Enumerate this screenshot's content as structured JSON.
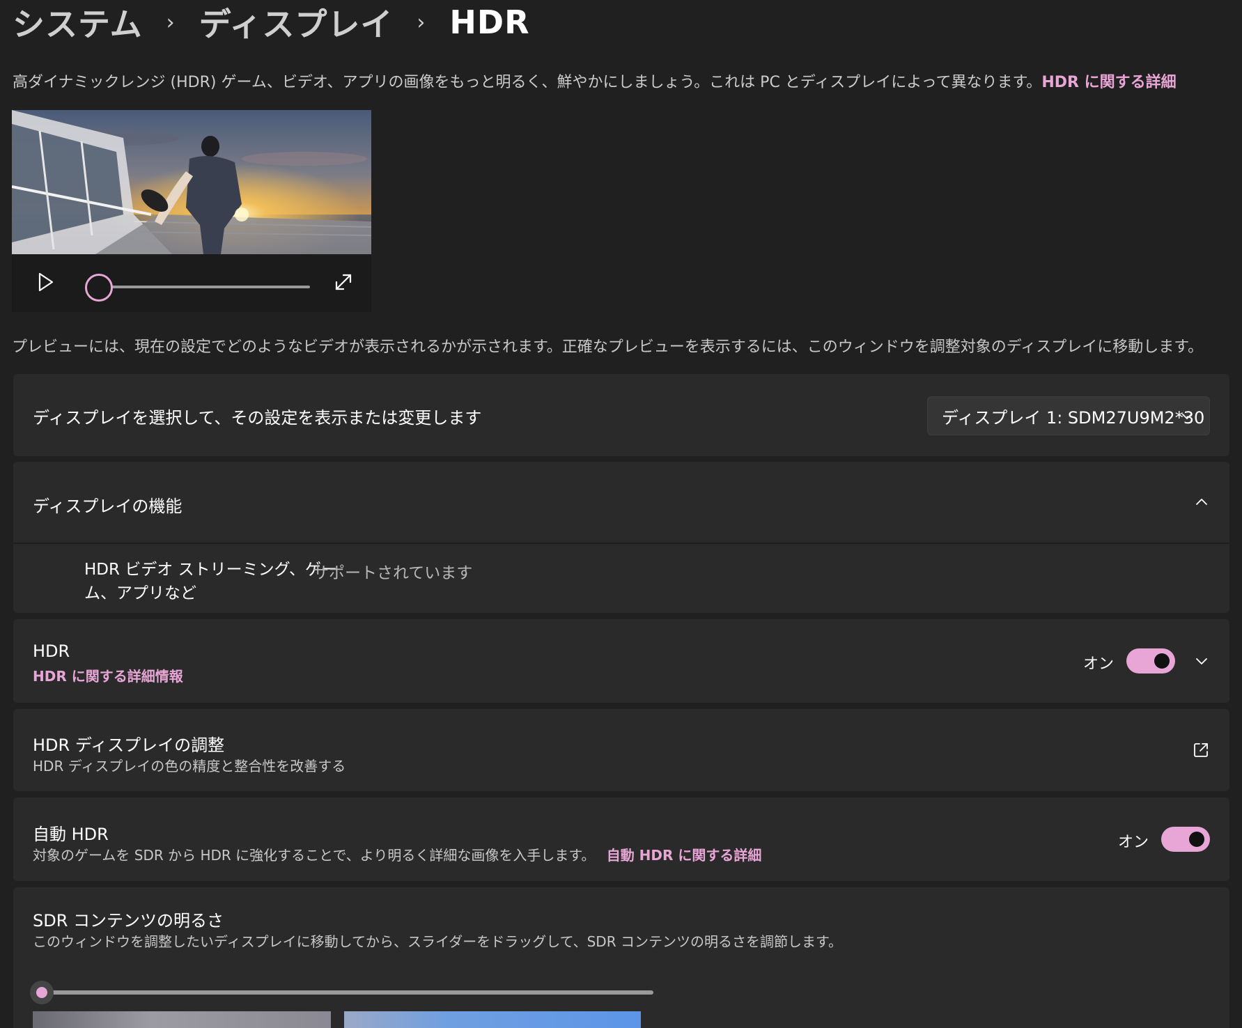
{
  "breadcrumb": {
    "items": [
      "システム",
      "ディスプレイ",
      "HDR"
    ],
    "separator": "›"
  },
  "intro": {
    "text": "高ダイナミックレンジ (HDR) ゲーム、ビデオ、アプリの画像をもっと明るく、鮮やかにしましょう。これは PC とディスプレイによって異なります。",
    "link": "HDR に関する詳細"
  },
  "video": {
    "progress": 0
  },
  "preview_note": "プレビューには、現在の設定でどのようなビデオが表示されるかが示されます。正確なプレビューを表示するには、このウィンドウを調整対象のディスプレイに移動します。",
  "display_select": {
    "label": "ディスプレイを選択して、その設定を表示または変更します",
    "selected": "ディスプレイ 1: SDM27U9M2*30"
  },
  "capabilities": {
    "title": "ディスプレイの機能",
    "feature_line1": "HDR ビデオ ストリーミング、ゲー",
    "feature_line2": "ム、アプリなど",
    "status": "サポートされています"
  },
  "hdr": {
    "title": "HDR",
    "link": "HDR に関する詳細情報",
    "state": "オン",
    "on": true
  },
  "calibration": {
    "title": "HDR ディスプレイの調整",
    "sub": "HDR ディスプレイの色の精度と整合性を改善する"
  },
  "auto_hdr": {
    "title": "自動 HDR",
    "sub": "対象のゲームを SDR から HDR に強化することで、より明るく詳細な画像を入手します。",
    "link": "自動 HDR に関する詳細",
    "state": "オン",
    "on": true
  },
  "sdr": {
    "title": "SDR コンテンツの明るさ",
    "sub": "このウィンドウを調整したいディスプレイに移動してから、スライダーをドラッグして、SDR コンテンツの明るさを調節します。",
    "level": 0
  },
  "colors": {
    "accent": "#e8a6d6",
    "background": "#202020",
    "card": "#2b2a2b"
  },
  "icons": {
    "breadcrumb_separator": "chevron-right-icon",
    "play": "play-icon",
    "fullscreen": "expand-icon",
    "dropdown": "chevron-down-icon",
    "collapse": "chevron-up-icon",
    "expand": "chevron-down-icon",
    "external": "external-link-icon"
  }
}
